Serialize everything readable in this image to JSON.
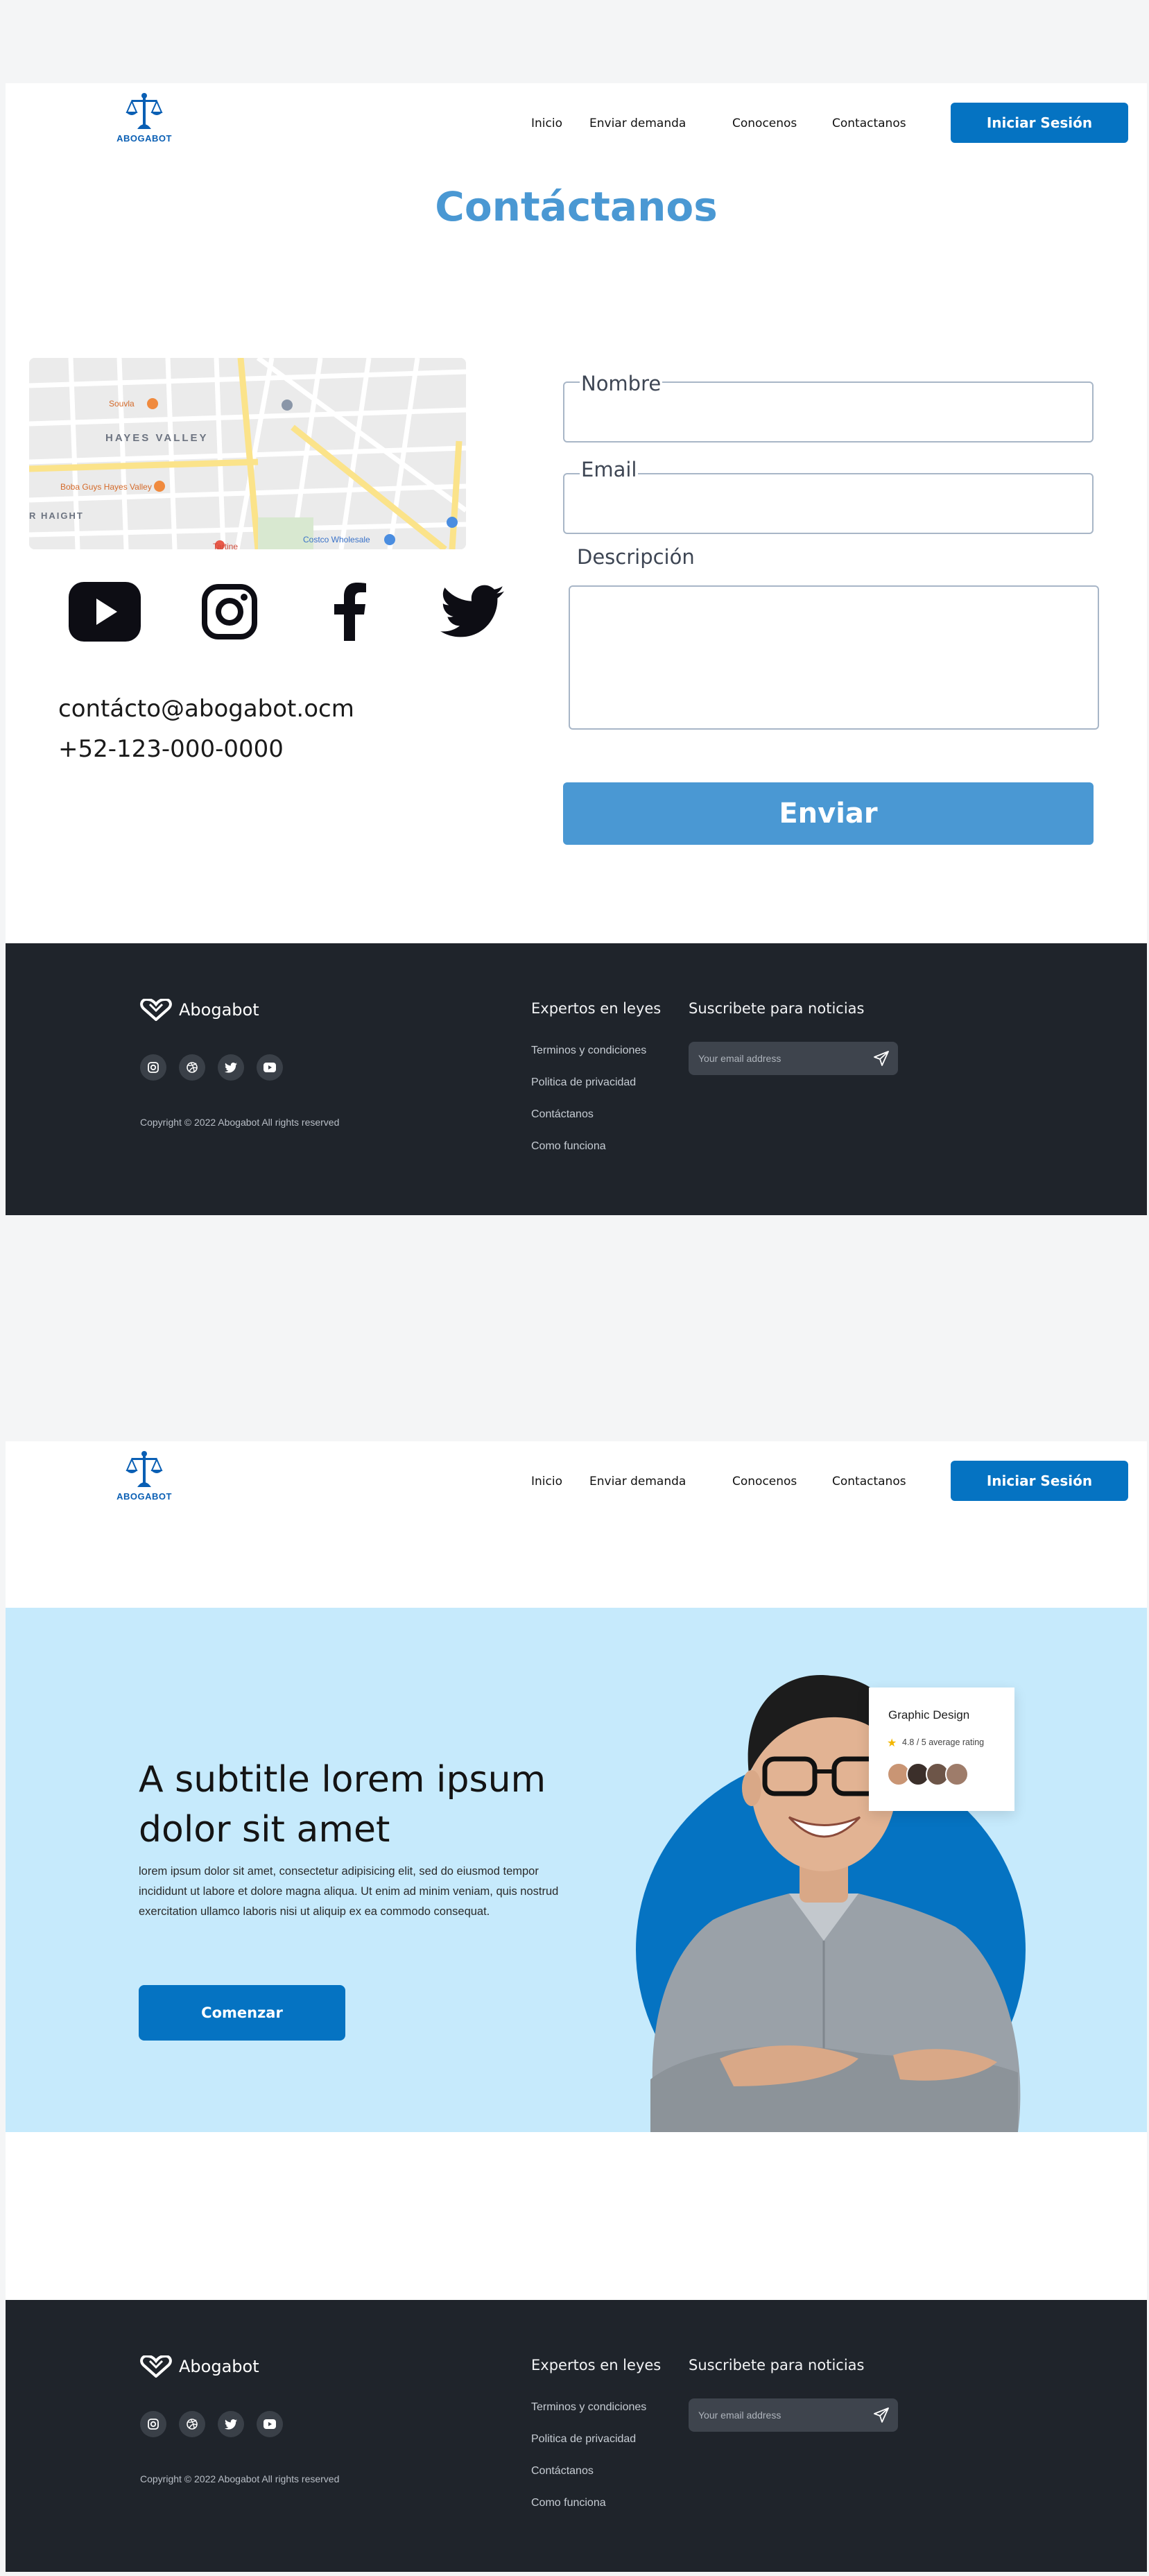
{
  "header": {
    "logo_text": "ABOGABOT",
    "nav": [
      "Inicio",
      "Enviar demanda",
      "Conocenos",
      "Contactanos"
    ],
    "login_label": "Iniciar Sesión",
    "accent_color": "#0573c2"
  },
  "contact": {
    "title": "Contáctanos",
    "map": {
      "labels": [
        "HAYES VALLEY",
        "Souvla",
        "Boba Guys Hayes Valley",
        "R HAIGHT",
        "Costco Wholesale",
        "Tartine"
      ]
    },
    "social_icons": [
      "youtube-icon",
      "instagram-icon",
      "facebook-icon",
      "twitter-icon"
    ],
    "email": "contácto@abogabot.ocm",
    "phone": "+52-123-000-0000",
    "form": {
      "name_label": "Nombre",
      "email_label": "Email",
      "description_label": "Descripción",
      "submit_label": "Enviar"
    }
  },
  "hero": {
    "title": "A subtitle lorem ipsum dolor sit amet",
    "text": "lorem ipsum dolor sit amet, consectetur adipisicing elit, sed do eiusmod tempor incididunt ut labore et dolore magna aliqua. Ut enim ad minim veniam, quis nostrud exercitation ullamco laboris nisi ut aliquip ex ea commodo consequat.",
    "cta_label": "Comenzar",
    "card": {
      "title": "Graphic Design",
      "rating_text": "4.8 / 5 average rating"
    },
    "background_color": "#c6eafc"
  },
  "footer": {
    "brand": "Abogabot",
    "social_icons": [
      "instagram-icon",
      "dribbble-icon",
      "twitter-icon",
      "youtube-icon"
    ],
    "copyright": "Copyright © 2022 Abogabot All rights reserved",
    "links_heading": "Expertos en leyes",
    "links": [
      "Terminos y condiciones",
      "Politica de privacidad",
      "Contáctanos",
      "Como funciona"
    ],
    "newsletter_heading": "Suscribete para noticias",
    "email_placeholder": "Your email address"
  }
}
